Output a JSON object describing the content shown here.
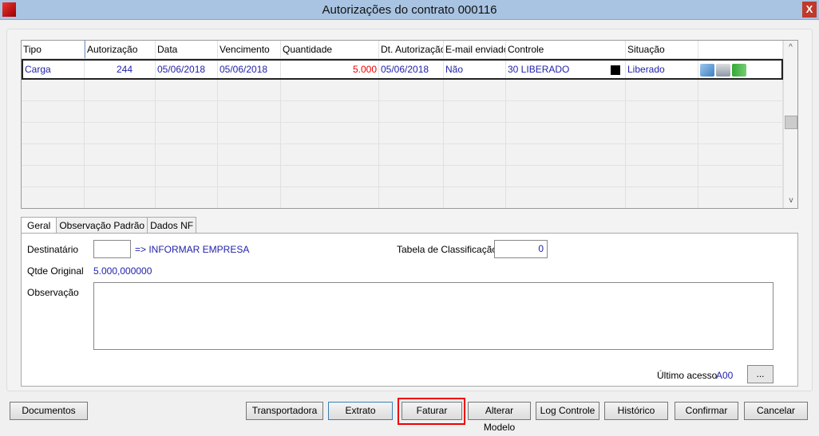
{
  "window": {
    "title": "Autorizações do contrato 000116",
    "close": "X"
  },
  "grid": {
    "columns": [
      "Tipo",
      "Autorização",
      "Data",
      "Vencimento",
      "Quantidade",
      "Dt. Autorização",
      "E-mail enviado",
      "Controle",
      "Situação",
      ""
    ],
    "rows": [
      {
        "tipo": "Carga",
        "autorizacao": "244",
        "data": "05/06/2018",
        "vencimento": "05/06/2018",
        "quantidade": "5.000",
        "dt_autorizacao": "05/06/2018",
        "email": "Não",
        "controle": "30  LIBERADO",
        "situacao": "Liberado"
      }
    ],
    "scroll_up": "^",
    "scroll_down": "v"
  },
  "tabs": [
    "Geral",
    "Observação Padrão",
    "Dados NF"
  ],
  "form": {
    "destinatario_label": "Destinatário",
    "destinatario_value": "",
    "destinatario_hint": "=> INFORMAR EMPRESA",
    "tabela_label": "Tabela de Classificação",
    "tabela_value": "0",
    "qtde_label": "Qtde Original",
    "qtde_value": "5.000,000000",
    "obs_label": "Observação",
    "obs_value": "",
    "ultimo_label": "Último acesso",
    "ultimo_value": "A00",
    "ellipsis": "..."
  },
  "buttons": {
    "documentos": "Documentos",
    "transportadora": "Transportadora",
    "extrato": "Extrato",
    "faturar": "Faturar",
    "alterar": "Alterar Modelo",
    "log": "Log Controle",
    "historico": "Histórico",
    "confirmar": "Confirmar",
    "cancelar": "Cancelar"
  }
}
